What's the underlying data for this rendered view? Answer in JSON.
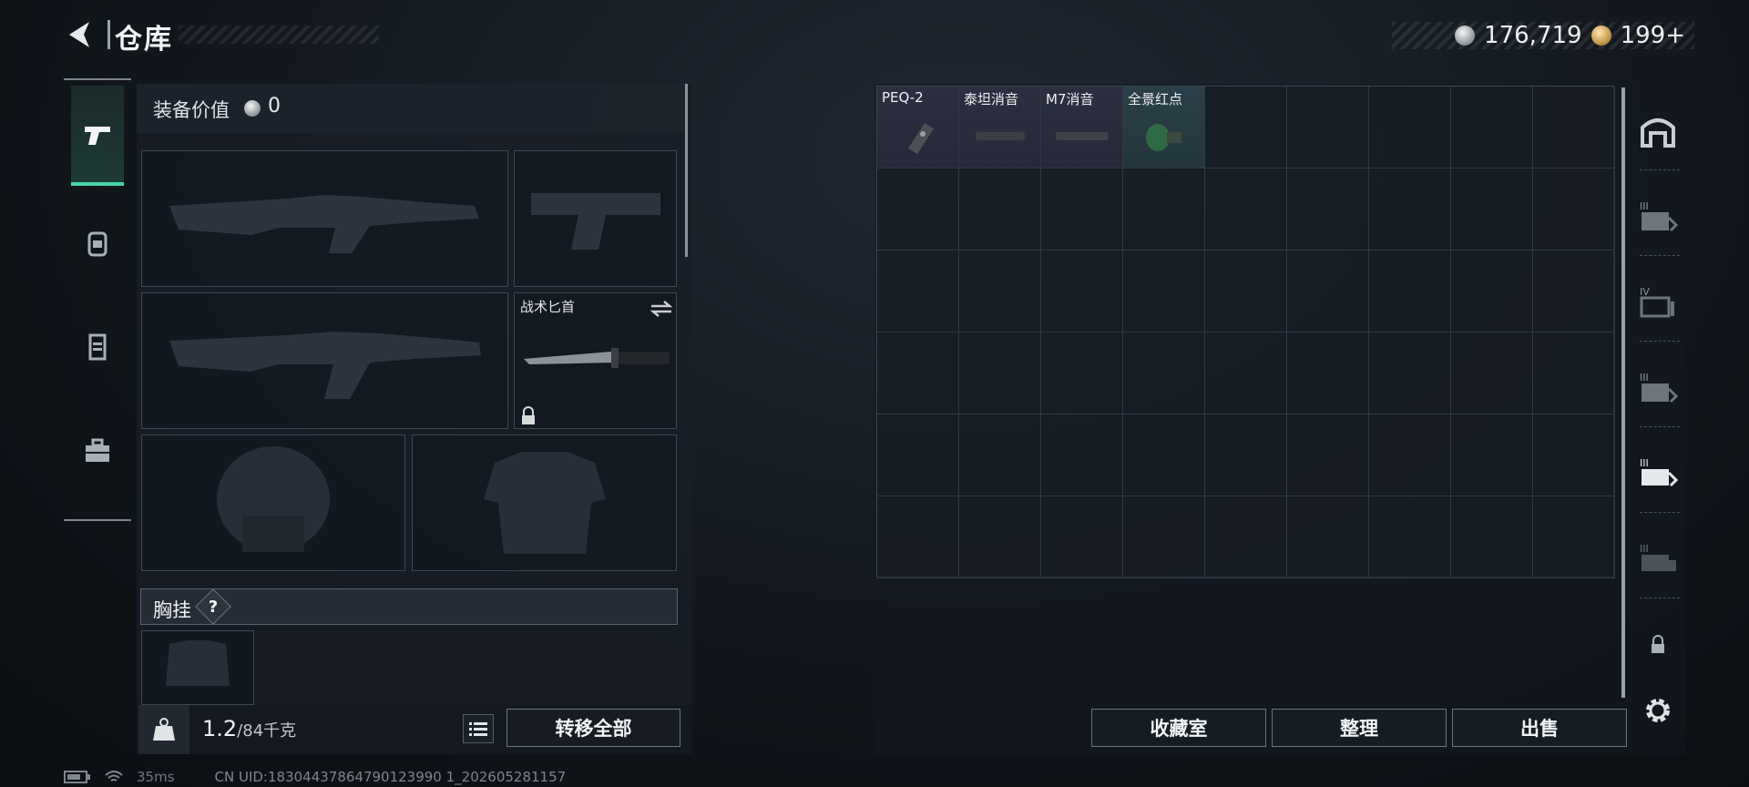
{
  "header": {
    "title": "仓库"
  },
  "currency": {
    "silver": "176,719",
    "gold": "199+"
  },
  "left_nav": {
    "items": [
      "weapons",
      "backpack",
      "armor",
      "toolbox"
    ]
  },
  "loadout": {
    "equip_value_label": "装备价值",
    "equip_value": "0",
    "slots": {
      "primary_1": "",
      "pistol": "",
      "primary_2": "",
      "melee_label": "战术匕首",
      "helmet": "",
      "armor": ""
    },
    "chest_rig_label": "胸挂",
    "chest_rig_help": "?",
    "weight_current": "1.2",
    "weight_max": "/84千克",
    "transfer_all_label": "转移全部"
  },
  "storage": {
    "items": [
      {
        "name": "PEQ-2",
        "rarity": "purple"
      },
      {
        "name": "泰坦消音",
        "rarity": "purple"
      },
      {
        "name": "M7消音",
        "rarity": "purple"
      },
      {
        "name": "全景红点",
        "rarity": "teal"
      }
    ],
    "buttons": {
      "collection": "收藏室",
      "organize": "整理",
      "sell": "出售"
    }
  },
  "right_tabs": [
    "storage-home",
    "III",
    "IV",
    "III",
    "III",
    "III",
    "locked"
  ],
  "status": {
    "ping": "35ms",
    "uid": "CN UID:18304437864790123990 1_202605281157"
  }
}
